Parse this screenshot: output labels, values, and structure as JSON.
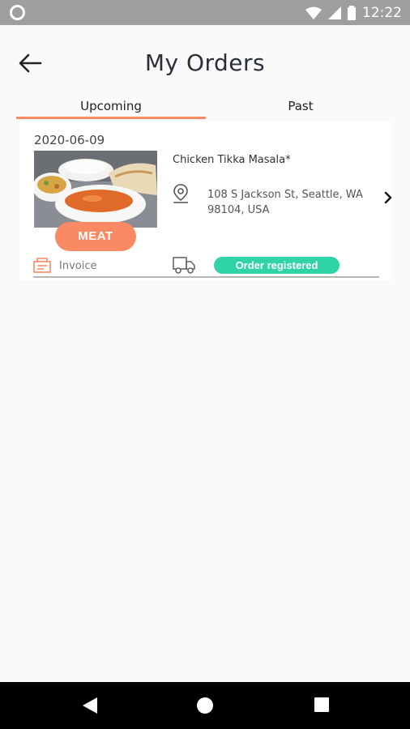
{
  "status_bar": {
    "time": "12:22"
  },
  "header": {
    "title": "My Orders"
  },
  "tabs": [
    {
      "label": "Upcoming",
      "active": true
    },
    {
      "label": "Past",
      "active": false
    }
  ],
  "orders": [
    {
      "date": "2020-06-09",
      "category": "MEAT",
      "dish": "Chicken Tikka Masala*",
      "address": "108 S Jackson St, Seattle, WA 98104, USA",
      "invoice_label": "Invoice",
      "status": "Order registered"
    }
  ],
  "colors": {
    "accent": "#f98a63",
    "status_green": "#2ed4a8",
    "statusbar": "#9e9e9e"
  },
  "icons": [
    "back-arrow-icon",
    "location-pin-icon",
    "chevron-right-icon",
    "invoice-icon",
    "delivery-truck-icon",
    "wifi-icon",
    "signal-icon",
    "battery-icon",
    "nav-back-icon",
    "nav-home-icon",
    "nav-recents-icon"
  ]
}
